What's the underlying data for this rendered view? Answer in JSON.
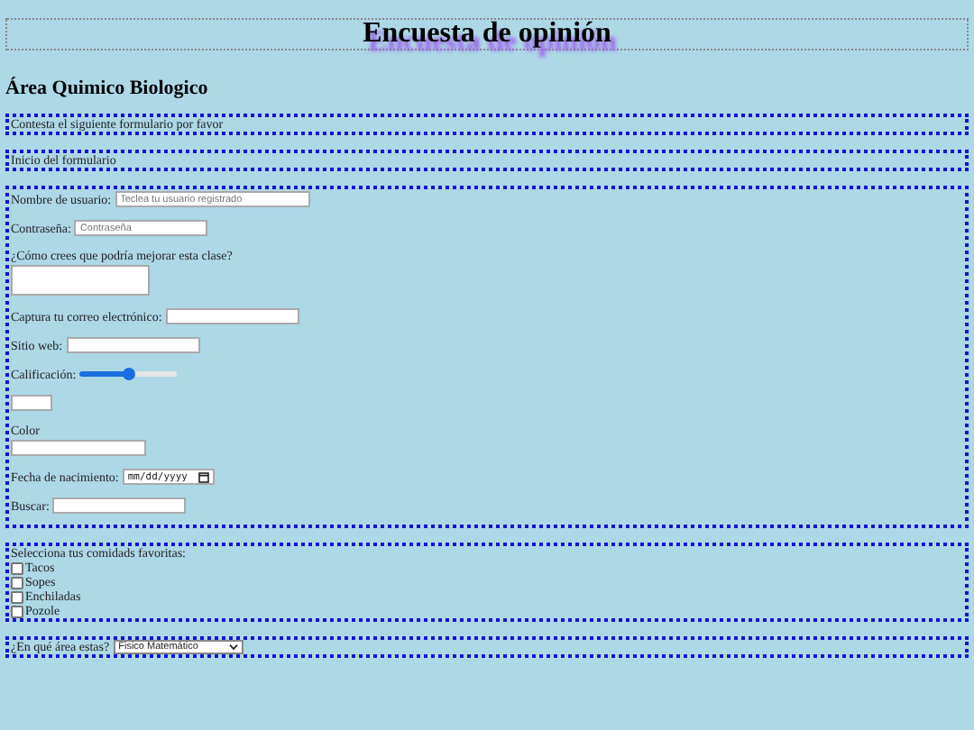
{
  "title": "Encuesta de opinión",
  "subtitle": "Área Quimico Biologico",
  "intro": "Contesta el siguiente formulario por favor",
  "form_start": "Inicio del formulario",
  "fields": [
    {
      "kind": "text",
      "label": "Nombre de usuario:",
      "placeholder": "Teclea tu usuario registrado"
    },
    {
      "kind": "password",
      "label": "Contraseña:",
      "placeholder": "Contraseña"
    },
    {
      "kind": "textarea",
      "label": "¿Cómo crees que podría mejorar esta clase?"
    },
    {
      "kind": "email",
      "label": "Captura tu correo electrónico:"
    },
    {
      "kind": "url",
      "label": "Sitio web:"
    },
    {
      "kind": "range",
      "label": "Calificación:",
      "level": 0.5
    },
    {
      "kind": "number"
    },
    {
      "kind": "color",
      "label": "Color"
    },
    {
      "kind": "date",
      "label": "Fecha de nacimiento:",
      "placeholder": "mm/dd/yyyy"
    },
    {
      "kind": "search",
      "label": "Buscar:"
    }
  ],
  "foods": {
    "label": "Selecciona tus comidads favoritas:",
    "options": [
      {
        "label": "Tacos",
        "checked": false
      },
      {
        "label": "Sopes",
        "checked": false
      },
      {
        "label": "Enchiladas",
        "checked": false
      },
      {
        "label": "Pozole",
        "checked": false
      }
    ]
  },
  "area": {
    "label": "¿En qué área estas?",
    "value": "Fisico Matemático"
  }
}
